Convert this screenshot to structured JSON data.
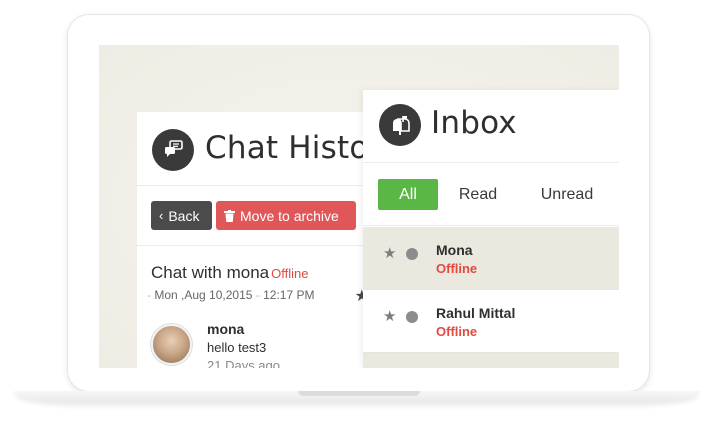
{
  "chat_history": {
    "title": "Chat Histo",
    "back_label": "Back",
    "back_icon": "chevron-left-icon",
    "archive_label": "Move to archive",
    "archive_icon": "trash-icon",
    "chat_with_label": "Chat with mona",
    "chat_status": "Offline",
    "date": "Mon ,Aug 10,2015",
    "time": "12:17 PM",
    "message": {
      "sender": "mona",
      "text": "hello test3",
      "ago": "21 Days ago"
    }
  },
  "inbox": {
    "title": "Inbox",
    "tabs": [
      {
        "label": "All"
      },
      {
        "label": "Read"
      },
      {
        "label": "Unread"
      }
    ],
    "rows": [
      {
        "name": "Mona",
        "status": "Offline"
      },
      {
        "name": "Rahul Mittal",
        "status": "Offline"
      }
    ]
  },
  "colors": {
    "active_tab": "#5bb745",
    "archive_button": "#e0575a",
    "back_button": "#4b4b4b",
    "offline_text": "#e04a3f",
    "icon_circle": "#3a3a3a"
  }
}
